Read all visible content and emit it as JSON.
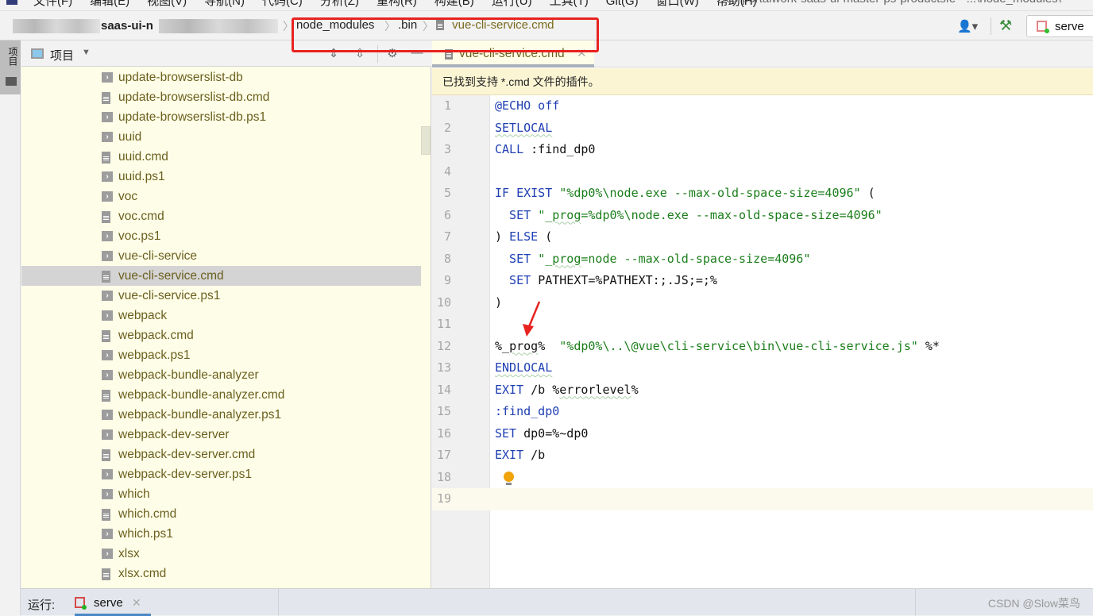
{
  "menubar": {
    "items": [
      "文件(F)",
      "编辑(E)",
      "视图(V)",
      "导航(N)",
      "代码(C)",
      "分析(Z)",
      "重构(R)",
      "构建(B)",
      "运行(U)",
      "工具(T)",
      "Git(G)",
      "窗口(W)",
      "帮助(H)"
    ],
    "window_title": "cs-portalwork-saas-ui-master-ps-productsfe - ...\\node_modules\\"
  },
  "navbar": {
    "project_name": "saas-ui-n",
    "breadcrumbs": [
      "node_modules",
      ".bin",
      "vue-cli-service.cmd"
    ],
    "run_config_label": "serve",
    "user_icon": "user-icon",
    "build_icon": "hammer-icon"
  },
  "left_strip": {
    "project_tab_label": "项目"
  },
  "project_panel": {
    "title": "项目",
    "header_icons": [
      "expand-all-icon",
      "collapse-all-icon",
      "gear-icon",
      "minimize-icon"
    ],
    "files": [
      {
        "name": "update-browserslist-db",
        "type": "shell"
      },
      {
        "name": "update-browserslist-db.cmd",
        "type": "doc"
      },
      {
        "name": "update-browserslist-db.ps1",
        "type": "shell"
      },
      {
        "name": "uuid",
        "type": "shell"
      },
      {
        "name": "uuid.cmd",
        "type": "doc"
      },
      {
        "name": "uuid.ps1",
        "type": "shell"
      },
      {
        "name": "voc",
        "type": "shell"
      },
      {
        "name": "voc.cmd",
        "type": "doc"
      },
      {
        "name": "voc.ps1",
        "type": "shell"
      },
      {
        "name": "vue-cli-service",
        "type": "shell"
      },
      {
        "name": "vue-cli-service.cmd",
        "type": "doc",
        "selected": true
      },
      {
        "name": "vue-cli-service.ps1",
        "type": "shell"
      },
      {
        "name": "webpack",
        "type": "shell"
      },
      {
        "name": "webpack.cmd",
        "type": "doc"
      },
      {
        "name": "webpack.ps1",
        "type": "shell"
      },
      {
        "name": "webpack-bundle-analyzer",
        "type": "shell"
      },
      {
        "name": "webpack-bundle-analyzer.cmd",
        "type": "doc"
      },
      {
        "name": "webpack-bundle-analyzer.ps1",
        "type": "shell"
      },
      {
        "name": "webpack-dev-server",
        "type": "shell"
      },
      {
        "name": "webpack-dev-server.cmd",
        "type": "doc"
      },
      {
        "name": "webpack-dev-server.ps1",
        "type": "shell"
      },
      {
        "name": "which",
        "type": "shell"
      },
      {
        "name": "which.cmd",
        "type": "doc"
      },
      {
        "name": "which.ps1",
        "type": "shell"
      },
      {
        "name": "xlsx",
        "type": "shell"
      },
      {
        "name": "xlsx.cmd",
        "type": "doc"
      }
    ]
  },
  "editor": {
    "tab_label": "vue-cli-service.cmd",
    "notice": "已找到支持 *.cmd 文件的插件。",
    "current_line": 19,
    "lines": [
      [
        {
          "t": "@ECHO off",
          "c": "kw"
        }
      ],
      [
        {
          "t": "SETLOCAL",
          "c": "kw wavy"
        }
      ],
      [
        {
          "t": "CALL",
          "c": "kw"
        },
        {
          "t": " :find_dp0",
          "c": ""
        }
      ],
      [],
      [
        {
          "t": "IF EXIST ",
          "c": "kw"
        },
        {
          "t": "\"%dp0%\\node.exe --max-old-space-size=4096\"",
          "c": "str"
        },
        {
          "t": " (",
          "c": ""
        }
      ],
      [
        {
          "t": "  SET ",
          "c": "kw"
        },
        {
          "t": "\"_",
          "c": "str"
        },
        {
          "t": "prog",
          "c": "str wavy"
        },
        {
          "t": "=%dp0%\\node.exe --max-old-space-size=4096\"",
          "c": "str"
        }
      ],
      [
        {
          "t": ") ",
          "c": ""
        },
        {
          "t": "ELSE",
          "c": "kw"
        },
        {
          "t": " (",
          "c": ""
        }
      ],
      [
        {
          "t": "  SET ",
          "c": "kw"
        },
        {
          "t": "\"_",
          "c": "str"
        },
        {
          "t": "prog",
          "c": "str wavy"
        },
        {
          "t": "=node --max-old-space-size=4096\"",
          "c": "str"
        }
      ],
      [
        {
          "t": "  SET ",
          "c": "kw"
        },
        {
          "t": "PATHEXT=%PATHEXT:;.JS;=;%",
          "c": ""
        }
      ],
      [
        {
          "t": ")",
          "c": ""
        }
      ],
      [],
      [
        {
          "t": "%_",
          "c": ""
        },
        {
          "t": "prog",
          "c": "wavy"
        },
        {
          "t": "%  ",
          "c": ""
        },
        {
          "t": "\"%dp0%\\..\\@vue\\cli-service\\bin\\vue-cli-service.js\"",
          "c": "str"
        },
        {
          "t": " %*",
          "c": ""
        }
      ],
      [
        {
          "t": "ENDLOCAL",
          "c": "kw wavy"
        }
      ],
      [
        {
          "t": "EXIT",
          "c": "kw"
        },
        {
          "t": " /b %",
          "c": ""
        },
        {
          "t": "errorlevel",
          "c": "wavy"
        },
        {
          "t": "%",
          "c": ""
        }
      ],
      [
        {
          "t": ":find_dp0",
          "c": "lab"
        }
      ],
      [
        {
          "t": "SET",
          "c": "kw"
        },
        {
          "t": " dp0=%~dp0",
          "c": ""
        }
      ],
      [
        {
          "t": "EXIT",
          "c": "kw"
        },
        {
          "t": " /b",
          "c": ""
        }
      ],
      [
        {
          "t": "",
          "c": "bulb"
        }
      ],
      []
    ]
  },
  "bottombar": {
    "run_label": "运行:",
    "run_tab_label": "serve",
    "watermark": "CSDN @Slow菜鸟"
  },
  "colors": {
    "highlight_box": "#e8231f",
    "keyword": "#1f3fb3",
    "string": "#1b7e1b",
    "tree_text": "#6b5f1e",
    "tree_bg": "#fefee8",
    "notice_bg": "#fcf5d4"
  }
}
